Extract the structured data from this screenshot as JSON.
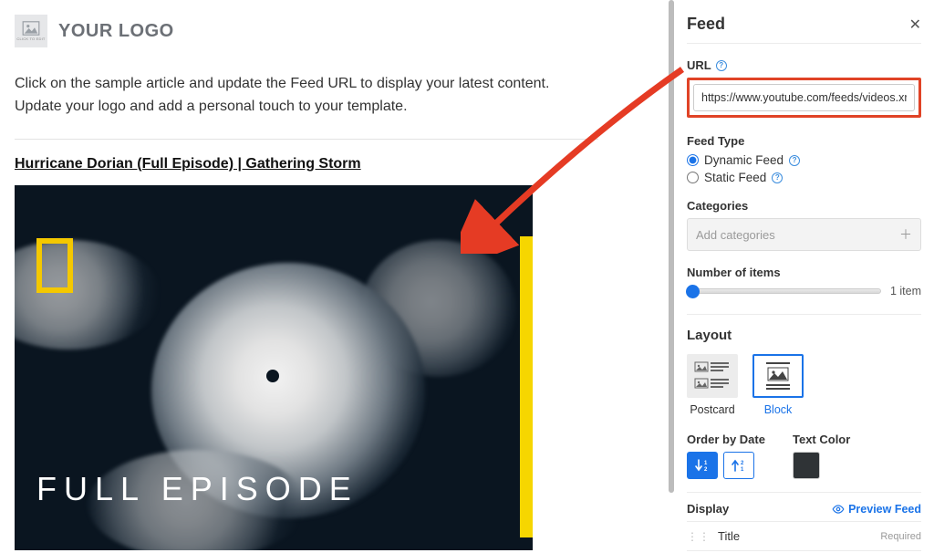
{
  "main": {
    "logo_tiny_label": "CLICK TO EDIT",
    "brand": "YOUR LOGO",
    "intro": "Click on the sample article and update the Feed URL to display your latest content. Update your logo and add a personal touch to your template.",
    "article_title": "Hurricane Dorian (Full Episode) | Gathering Storm",
    "hero_overlay_text": "FULL EPISODE"
  },
  "panel": {
    "title": "Feed",
    "url": {
      "label": "URL",
      "value": "https://www.youtube.com/feeds/videos.xr"
    },
    "feed_type": {
      "label": "Feed Type",
      "options": {
        "dynamic": "Dynamic Feed",
        "static": "Static Feed"
      },
      "selected": "dynamic"
    },
    "categories": {
      "label": "Categories",
      "placeholder": "Add categories"
    },
    "items": {
      "label": "Number of items",
      "value_label": "1 item"
    },
    "layout": {
      "title": "Layout",
      "postcard": "Postcard",
      "block": "Block"
    },
    "order": {
      "label": "Order by Date"
    },
    "text_color": {
      "label": "Text Color",
      "hex": "#2f3336"
    },
    "display": {
      "label": "Display",
      "preview": "Preview Feed",
      "row_title": "Title",
      "required": "Required"
    }
  }
}
